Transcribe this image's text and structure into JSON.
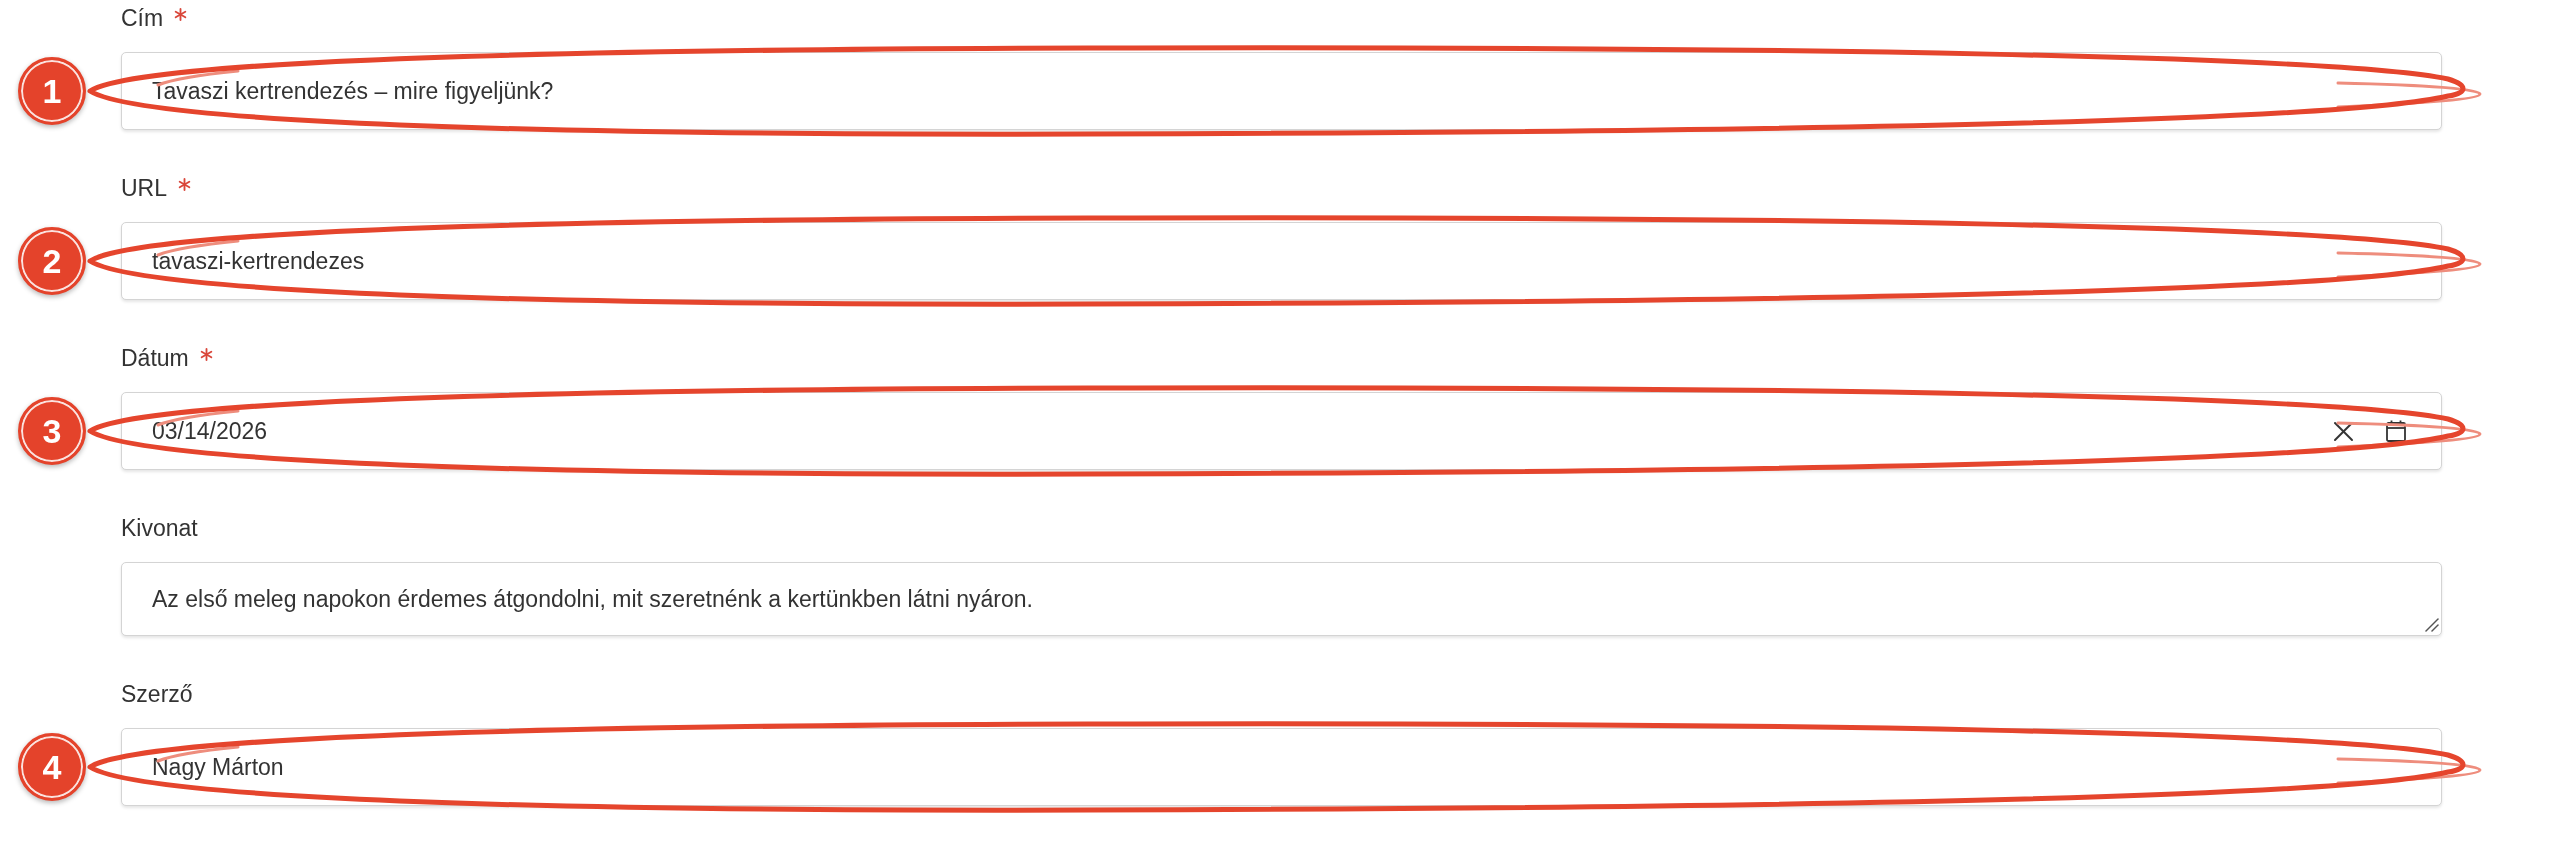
{
  "fields": [
    {
      "kind": "text",
      "label": "Cím",
      "required": true,
      "value": "Tavaszi kertrendezés – mire figyeljünk?",
      "annotation": "1"
    },
    {
      "kind": "text",
      "label": "URL",
      "required": true,
      "value": "tavaszi-kertrendezes",
      "annotation": "2"
    },
    {
      "kind": "date",
      "label": "Dátum",
      "required": true,
      "value": "03/14/2026",
      "annotation": "3"
    },
    {
      "kind": "textarea",
      "label": "Kivonat",
      "required": false,
      "value": "Az első meleg napokon érdemes átgondolni, mit szeretnénk a kertünkben látni nyáron."
    },
    {
      "kind": "text",
      "label": "Szerző",
      "required": false,
      "value": "Nagy Márton",
      "annotation": "4"
    }
  ]
}
